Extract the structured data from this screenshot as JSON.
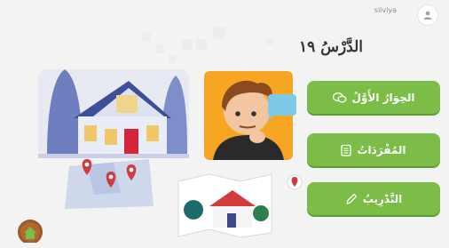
{
  "user": {
    "name": "silviya"
  },
  "lesson": {
    "title": "الدَّرْسُ ١٩"
  },
  "menu": [
    {
      "label": "الحِوَارُ الأَوَّلُ",
      "icon": "chat-bubbles-icon"
    },
    {
      "label": "المُفْرَدَاتُ",
      "icon": "notebook-icon"
    },
    {
      "label": "التَّدْرِيبُ",
      "icon": "pencil-icon"
    }
  ],
  "colors": {
    "button": "#7bbd46",
    "button_shadow": "#5e9f2f",
    "home_button": "#9a5a2a",
    "boy_card": "#f6a623"
  }
}
